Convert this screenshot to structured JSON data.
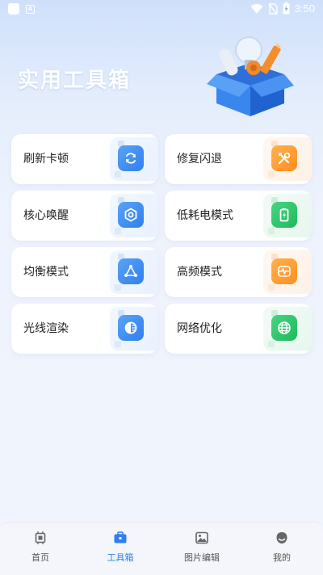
{
  "status_bar": {
    "time": "3:50"
  },
  "header": {
    "title": "实用工具箱"
  },
  "tools": [
    {
      "label": "刷新卡顿",
      "icon": "refresh-icon",
      "color": "#2f7ff0"
    },
    {
      "label": "修复闪退",
      "icon": "repair-tools-icon",
      "color": "#ff8d1f"
    },
    {
      "label": "核心唤醒",
      "icon": "core-hexagon-icon",
      "color": "#2f7ff0"
    },
    {
      "label": "低耗电模式",
      "icon": "battery-icon",
      "color": "#20b85c"
    },
    {
      "label": "均衡模式",
      "icon": "network-triangle-icon",
      "color": "#2f7ff0"
    },
    {
      "label": "高频模式",
      "icon": "pulse-icon",
      "color": "#ff8d1f"
    },
    {
      "label": "光线渲染",
      "icon": "contrast-icon",
      "color": "#2f7ff0"
    },
    {
      "label": "网络优化",
      "icon": "globe-icon",
      "color": "#20b85c"
    }
  ],
  "nav": {
    "items": [
      {
        "label": "首页",
        "icon": "chip-icon"
      },
      {
        "label": "工具箱",
        "icon": "toolbox-icon",
        "active": true
      },
      {
        "label": "图片编辑",
        "icon": "image-icon"
      },
      {
        "label": "我的",
        "icon": "profile-icon"
      }
    ]
  }
}
